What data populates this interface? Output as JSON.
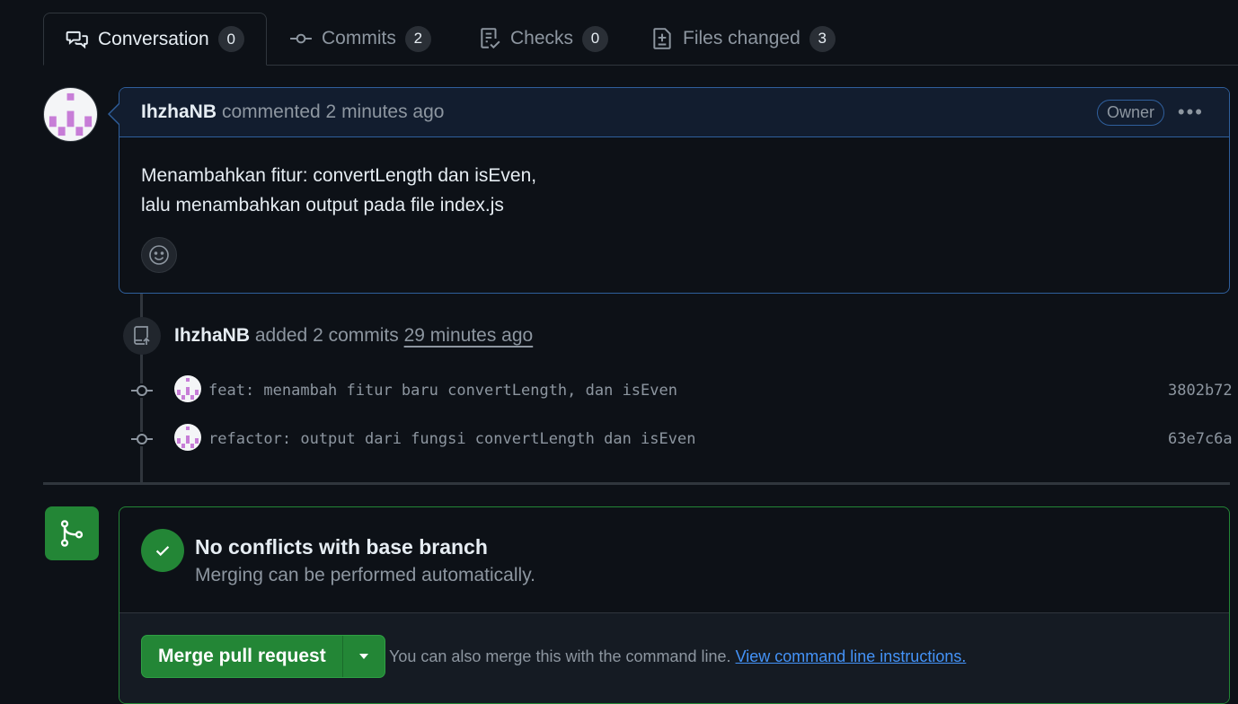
{
  "tabs": [
    {
      "label": "Conversation",
      "count": "0",
      "icon": "comment-discussion-icon"
    },
    {
      "label": "Commits",
      "count": "2",
      "icon": "git-commit-icon"
    },
    {
      "label": "Checks",
      "count": "0",
      "icon": "checklist-icon"
    },
    {
      "label": "Files changed",
      "count": "3",
      "icon": "file-diff-icon"
    }
  ],
  "comment": {
    "author": "IhzhaNB",
    "action": "commented 2 minutes ago",
    "role_badge": "Owner",
    "body_line1": "Menambahkan fitur: convertLength dan isEven,",
    "body_line2": "lalu menambahkan output pada file index.js"
  },
  "commits_event": {
    "author": "IhzhaNB",
    "action": "added 2 commits",
    "time": "29 minutes ago",
    "commits": [
      {
        "message": "feat: menambah fitur baru convertLength, dan isEven",
        "sha": "3802b72"
      },
      {
        "message": "refactor: output dari fungsi convertLength dan isEven",
        "sha": "63e7c6a"
      }
    ]
  },
  "merge": {
    "title": "No conflicts with base branch",
    "subtitle": "Merging can be performed automatically.",
    "button_label": "Merge pull request",
    "hint_text": "You can also merge this with the command line.",
    "hint_link": "View command line instructions."
  },
  "colors": {
    "background": "#0d1117",
    "accent_blue": "#2f5f9c",
    "success_green": "#238636",
    "avatar_purple": "#c77dd7"
  }
}
